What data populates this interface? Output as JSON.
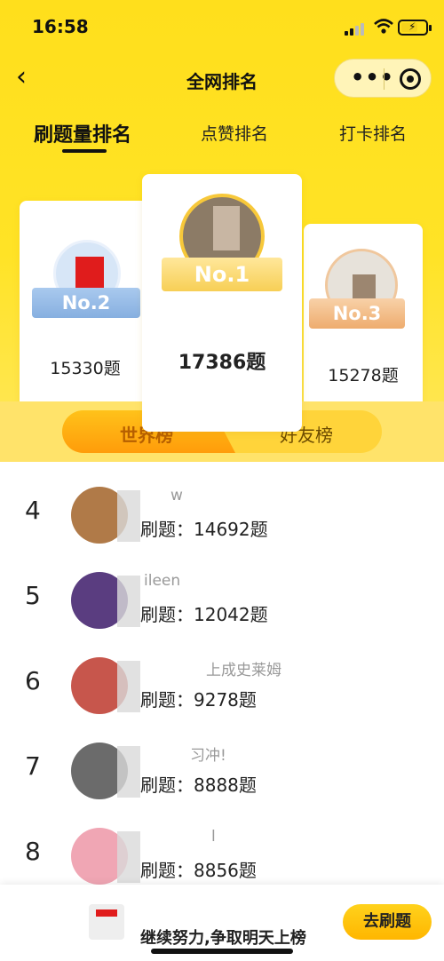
{
  "status": {
    "time": "16:58"
  },
  "nav": {
    "title": "全网排名"
  },
  "tabs": [
    {
      "label": "刷题量排名",
      "active": true
    },
    {
      "label": "点赞排名",
      "active": false
    },
    {
      "label": "打卡排名",
      "active": false
    }
  ],
  "podium": [
    {
      "rank_label": "No.2",
      "name": "",
      "count": "15330题"
    },
    {
      "rank_label": "No.1",
      "name": "",
      "count": "17386题"
    },
    {
      "rank_label": "No.3",
      "name": "",
      "count": "15278题"
    }
  ],
  "switch": {
    "world": "世界榜",
    "friends": "好友榜"
  },
  "list": [
    {
      "rank": "4",
      "name": "w",
      "count": "刷题：14692题"
    },
    {
      "rank": "5",
      "name": "ileen",
      "count": "刷题：12042题"
    },
    {
      "rank": "6",
      "name": "上成史莱姆",
      "count": "刷题：9278题"
    },
    {
      "rank": "7",
      "name": "习冲!",
      "count": "刷题：8888题"
    },
    {
      "rank": "8",
      "name": "l",
      "count": "刷题：8856题"
    }
  ],
  "bottom": {
    "message": "继续努力,争取明天上榜",
    "button": "去刷题"
  },
  "colors": {
    "brand_yellow": "#ffdf1c",
    "button_orange": "#ff9c0a"
  }
}
